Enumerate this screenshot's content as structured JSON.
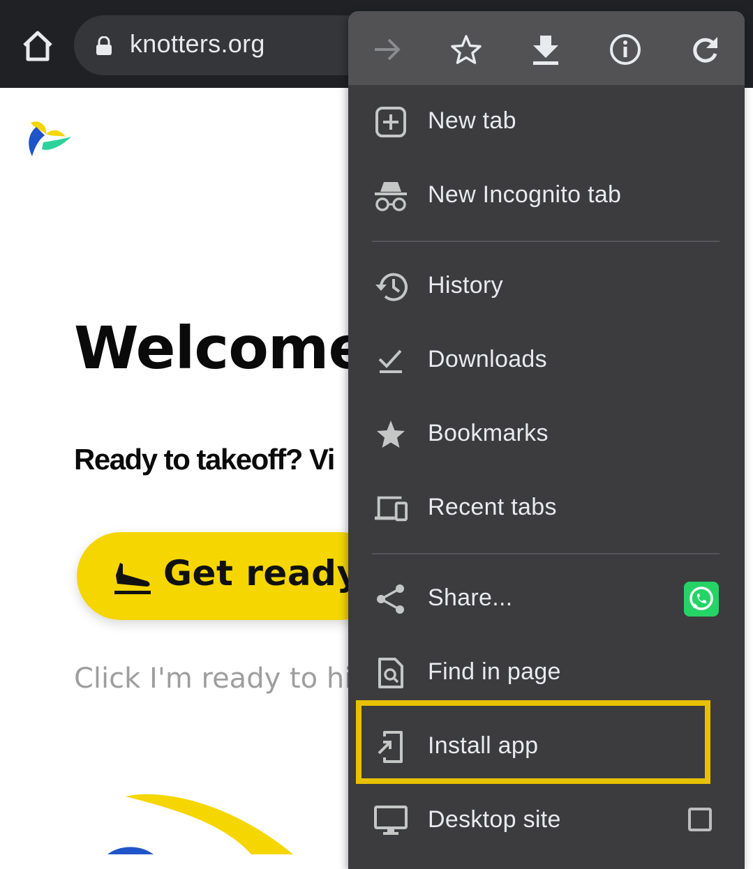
{
  "browser": {
    "url": "knotters.org"
  },
  "page": {
    "welcome": "Welcome",
    "subtitle": "Ready to takeoff? Vi",
    "cta_label": "Get ready",
    "hint": "Click I'm ready to hic"
  },
  "menu": {
    "toolbar": [
      "forward-icon",
      "bookmark-star-icon",
      "download-icon",
      "info-icon",
      "reload-icon"
    ],
    "items": [
      {
        "label": "New tab",
        "icon": "new-tab-icon"
      },
      {
        "label": "New Incognito tab",
        "icon": "incognito-icon"
      },
      {
        "label": "History",
        "icon": "history-icon"
      },
      {
        "label": "Downloads",
        "icon": "downloads-icon"
      },
      {
        "label": "Bookmarks",
        "icon": "bookmarks-star-icon"
      },
      {
        "label": "Recent tabs",
        "icon": "devices-icon"
      },
      {
        "label": "Share...",
        "icon": "share-icon"
      },
      {
        "label": "Find in page",
        "icon": "find-in-page-icon"
      },
      {
        "label": "Install app",
        "icon": "install-app-icon"
      },
      {
        "label": "Desktop site",
        "icon": "desktop-icon"
      }
    ],
    "highlight_color": "#e8c200"
  },
  "colors": {
    "topbar": "#202124",
    "menu_bg": "#3c3c3e",
    "cta_bg": "#f5d600",
    "whatsapp": "#25d366"
  }
}
